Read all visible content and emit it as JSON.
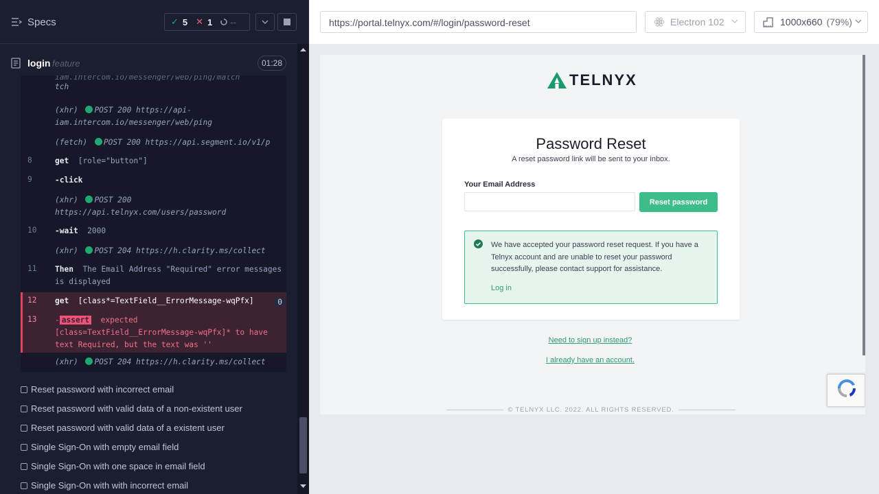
{
  "runner": {
    "header_title": "Specs",
    "stats": {
      "passed": "5",
      "failed": "1",
      "pending": "--"
    },
    "spec": {
      "name": "login",
      "ext": "feature",
      "duration": "01:28"
    },
    "commands": [
      {
        "num": "",
        "text": "iam.intercom.io/messenger/web/ping/match",
        "display": "tch"
      },
      {
        "num": "",
        "prefix": "(xhr)",
        "line": "POST 200 https://api-iam.intercom.io/messenger/web/ping"
      },
      {
        "num": "",
        "prefix": "(fetch)",
        "line": "POST 200 https://api.segment.io/v1/p"
      },
      {
        "num": "8",
        "keyword": "get",
        "arg": "[role=\"button\"]"
      },
      {
        "num": "9",
        "keyword": "-click"
      },
      {
        "num": "",
        "prefix": "(xhr)",
        "line": "POST 200 https://api.telnyx.com/users/password"
      },
      {
        "num": "10",
        "keyword": "-wait",
        "arg": "2000"
      },
      {
        "num": "",
        "prefix": "(xhr)",
        "line": "POST 204 https://h.clarity.ms/collect"
      },
      {
        "num": "11",
        "keyword": "Then",
        "arg": "The Email Address \"Required\" error messages is displayed"
      },
      {
        "num": "12",
        "keyword": "get",
        "arg": "[class*=TextField__ErrorMessage-wqPfx]",
        "index": "0"
      },
      {
        "num": "13",
        "keyword": "-",
        "tag": "assert",
        "arg": "expected [class=TextField__ErrorMessage-wqPfx]* to have text Required, but the text was ''"
      },
      {
        "num": "",
        "prefix": "(xhr)",
        "line": "POST 204 https://h.clarity.ms/collect"
      }
    ],
    "tests": [
      "Reset password with incorrect email",
      "Reset password with valid data of a non-existent user",
      "Reset password with valid data of a existent user",
      "Single Sign-On with empty email field",
      "Single Sign-On with one space in email field",
      "Single Sign-On with with incorrect email"
    ]
  },
  "aut": {
    "url": "https://portal.telnyx.com/#/login/password-reset",
    "browser": "Electron 102",
    "viewport": "1000x660",
    "zoom": "(79%)"
  },
  "page": {
    "logo_text": "TELNYX",
    "title": "Password Reset",
    "subtitle": "A reset password link will be sent to your inbox.",
    "email_label": "Your Email Address",
    "email_value": "",
    "reset_button": "Reset password",
    "alert_message": "We have accepted your password reset request. If you have a Telnyx account and are unable to reset your password successfully, please contact support for assistance.",
    "alert_link": "Log in",
    "signup_link": "Need to sign up instead?",
    "have_account_link": "I already have an account.",
    "copyright": "© TELNYX LLC. 2022. ALL RIGHTS RESERVED."
  },
  "colors": {
    "runner_bg": "#1b1e2e",
    "pass": "#1fa971",
    "fail": "#f05d75",
    "brand_green": "#3dbd8a"
  }
}
